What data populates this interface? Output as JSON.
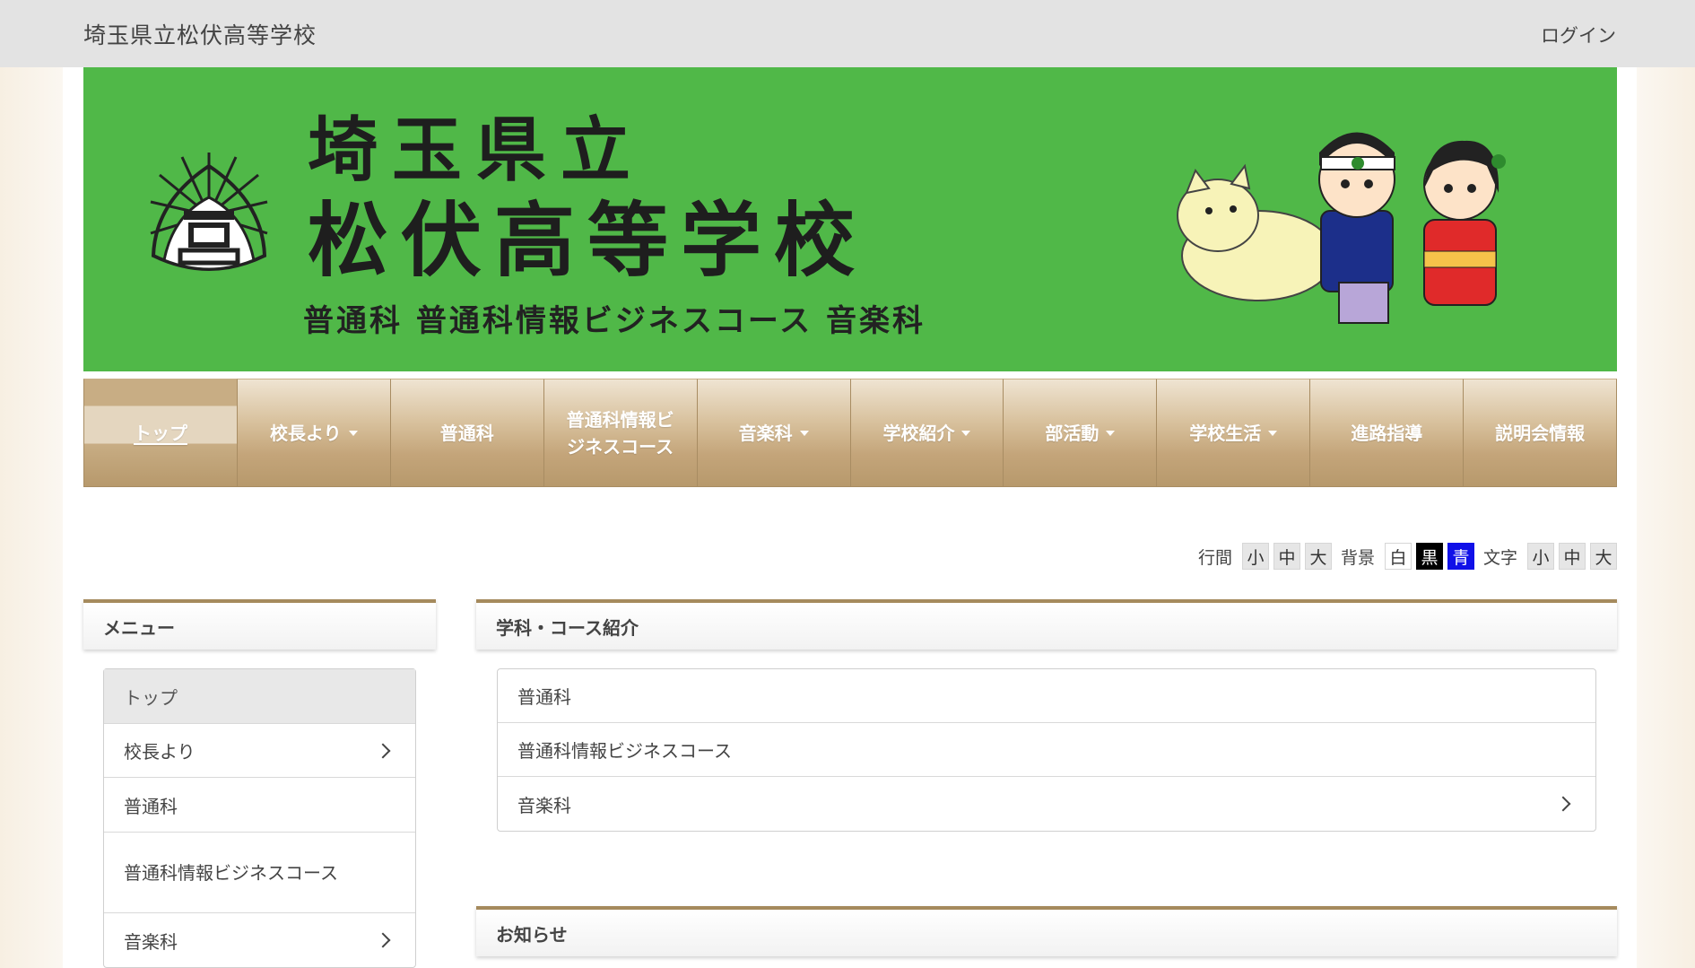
{
  "header": {
    "site_title": "埼玉県立松伏高等学校",
    "login_label": "ログイン"
  },
  "banner": {
    "line1": "埼玉県立",
    "line2": "松伏高等学校",
    "line3": "普通科 普通科情報ビジネスコース 音楽科",
    "bg_color": "#50b848"
  },
  "nav": {
    "items": [
      {
        "label": "トップ",
        "dropdown": false
      },
      {
        "label": "校長より",
        "dropdown": true
      },
      {
        "label": "普通科",
        "dropdown": false
      },
      {
        "label": "普通科情報ビジネスコース",
        "dropdown": false
      },
      {
        "label": "音楽科",
        "dropdown": true
      },
      {
        "label": "学校紹介",
        "dropdown": true
      },
      {
        "label": "部活動",
        "dropdown": true
      },
      {
        "label": "学校生活",
        "dropdown": true
      },
      {
        "label": "進路指導",
        "dropdown": false
      },
      {
        "label": "説明会情報",
        "dropdown": false
      }
    ]
  },
  "accessibility": {
    "line_spacing_label": "行間",
    "background_label": "背景",
    "text_label": "文字",
    "size_small": "小",
    "size_medium": "中",
    "size_large": "大",
    "bg_white": "白",
    "bg_black": "黒",
    "bg_blue": "青"
  },
  "sidebar": {
    "title": "メニュー",
    "items": [
      {
        "label": "トップ",
        "has_children": false
      },
      {
        "label": "校長より",
        "has_children": true
      },
      {
        "label": "普通科",
        "has_children": false
      },
      {
        "label": "普通科情報ビジネスコース",
        "has_children": false
      },
      {
        "label": "音楽科",
        "has_children": true
      }
    ]
  },
  "courses": {
    "title": "学科・コース紹介",
    "items": [
      {
        "label": "普通科",
        "has_children": false
      },
      {
        "label": "普通科情報ビジネスコース",
        "has_children": false
      },
      {
        "label": "音楽科",
        "has_children": true
      }
    ]
  },
  "news": {
    "title": "お知らせ"
  },
  "colors": {
    "accent_border": "#a58a5d",
    "nav_gold": "#c4a57a"
  }
}
